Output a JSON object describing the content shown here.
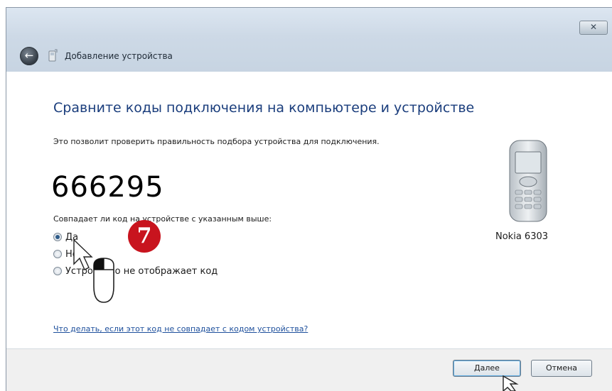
{
  "window": {
    "title": "Добавление устройства",
    "close_label": "✕"
  },
  "main": {
    "heading": "Сравните коды подключения на компьютере и устройстве",
    "description": "Это позволит проверить правильность подбора устройства для подключения.",
    "pairing_code": "666295",
    "question": "Совпадает ли код на устройстве с указанным выше:",
    "options": [
      {
        "label": "Да",
        "checked": true
      },
      {
        "label": "Нет",
        "checked": false
      },
      {
        "label": "Устройство не отображает код",
        "checked": false
      }
    ],
    "device_name": "Nokia 6303",
    "help_link": "Что делать, если этот код не совпадает с кодом устройства?"
  },
  "footer": {
    "next_label": "Далее",
    "cancel_label": "Отмена"
  },
  "annotation": {
    "step_number": "7",
    "color": "#c8141e"
  },
  "icons": [
    "back-arrow-icon",
    "device-icon",
    "phone-icon",
    "close-icon",
    "mouse-cursor-icon",
    "mouse-icon"
  ]
}
